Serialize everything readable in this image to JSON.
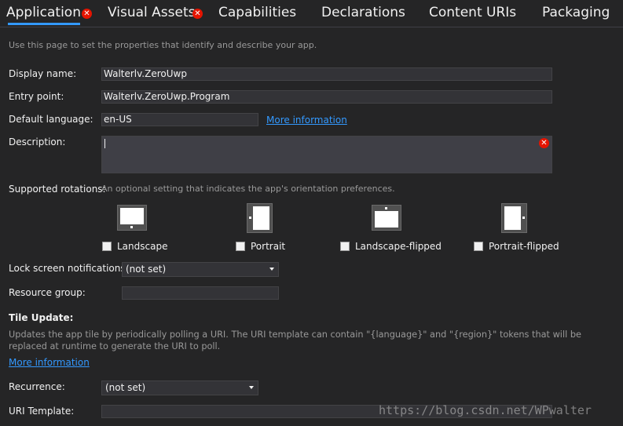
{
  "tabs": [
    {
      "label": "Application",
      "error": true,
      "active": true
    },
    {
      "label": "Visual Assets",
      "error": true,
      "active": false
    },
    {
      "label": "Capabilities",
      "error": false,
      "active": false
    },
    {
      "label": "Declarations",
      "error": false,
      "active": false
    },
    {
      "label": "Content URIs",
      "error": false,
      "active": false
    },
    {
      "label": "Packaging",
      "error": false,
      "active": false
    }
  ],
  "intro": "Use this page to set the properties that identify and describe your app.",
  "form": {
    "display_name": {
      "label": "Display name:",
      "value": "Walterlv.ZeroUwp"
    },
    "entry_point": {
      "label": "Entry point:",
      "value": "Walterlv.ZeroUwp.Program"
    },
    "default_language": {
      "label": "Default language:",
      "value": "en-US",
      "link": "More information"
    },
    "description": {
      "label": "Description:",
      "value": ""
    }
  },
  "rotations": {
    "label": "Supported rotations:",
    "hint": "An optional setting that indicates the app's orientation preferences.",
    "options": [
      {
        "label": "Landscape",
        "checked": false
      },
      {
        "label": "Portrait",
        "checked": false
      },
      {
        "label": "Landscape-flipped",
        "checked": false
      },
      {
        "label": "Portrait-flipped",
        "checked": false
      }
    ]
  },
  "lock_screen": {
    "label": "Lock screen notifications:",
    "value": "(not set)"
  },
  "resource_group": {
    "label": "Resource group:",
    "value": ""
  },
  "tile_update": {
    "heading": "Tile Update:",
    "desc_line1": "Updates the app tile by periodically polling a URI. The URI template can contain \"{language}\" and \"{region}\" tokens that will be",
    "desc_line2": "replaced at runtime to generate the URI to poll.",
    "link": "More information",
    "recurrence": {
      "label": "Recurrence:",
      "value": "(not set)"
    },
    "uri_template": {
      "label": "URI Template:",
      "value": ""
    }
  },
  "watermark": "https://blog.csdn.net/WPwalter",
  "colors": {
    "accent": "#3399ff",
    "error": "#e51400",
    "background": "#252526"
  }
}
